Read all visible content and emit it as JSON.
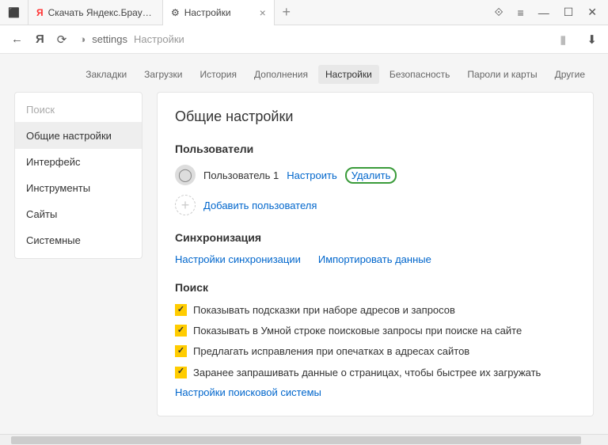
{
  "tabs": {
    "tab1_icon": "⬛",
    "tab1_label": "",
    "tab2_icon": "Я",
    "tab2_label": "Скачать Яндекс.Браузер д",
    "tab3_icon": "⚙",
    "tab3_label": "Настройки"
  },
  "window": {
    "bookmark": "⟐",
    "menu": "≡",
    "min": "—",
    "max": "☐",
    "close": "✕"
  },
  "toolbar": {
    "back": "←",
    "yandex": "Я",
    "reload": "⟳",
    "lock": "◑",
    "addr1": "settings",
    "addr2": "Настройки",
    "mark": "▮",
    "download": "⬇"
  },
  "topnav": {
    "t0": "Закладки",
    "t1": "Загрузки",
    "t2": "История",
    "t3": "Дополнения",
    "t4": "Настройки",
    "t5": "Безопасность",
    "t6": "Пароли и карты",
    "t7": "Другие"
  },
  "sidebar": {
    "search": "Поиск",
    "s0": "Общие настройки",
    "s1": "Интерфейс",
    "s2": "Инструменты",
    "s3": "Сайты",
    "s4": "Системные"
  },
  "panel": {
    "title": "Общие настройки",
    "users_h": "Пользователи",
    "user1": "Пользователь 1",
    "configure": "Настроить",
    "delete": "Удалить",
    "adduser": "Добавить пользователя",
    "sync_h": "Синхронизация",
    "sync_settings": "Настройки синхронизации",
    "import": "Импортировать данные",
    "search_h": "Поиск",
    "c0": "Показывать подсказки при наборе адресов и запросов",
    "c1": "Показывать в Умной строке поисковые запросы при поиске на сайте",
    "c2": "Предлагать исправления при опечатках в адресах сайтов",
    "c3": "Заранее запрашивать данные о страницах, чтобы быстрее их загружать",
    "search_engine": "Настройки поисковой системы"
  }
}
